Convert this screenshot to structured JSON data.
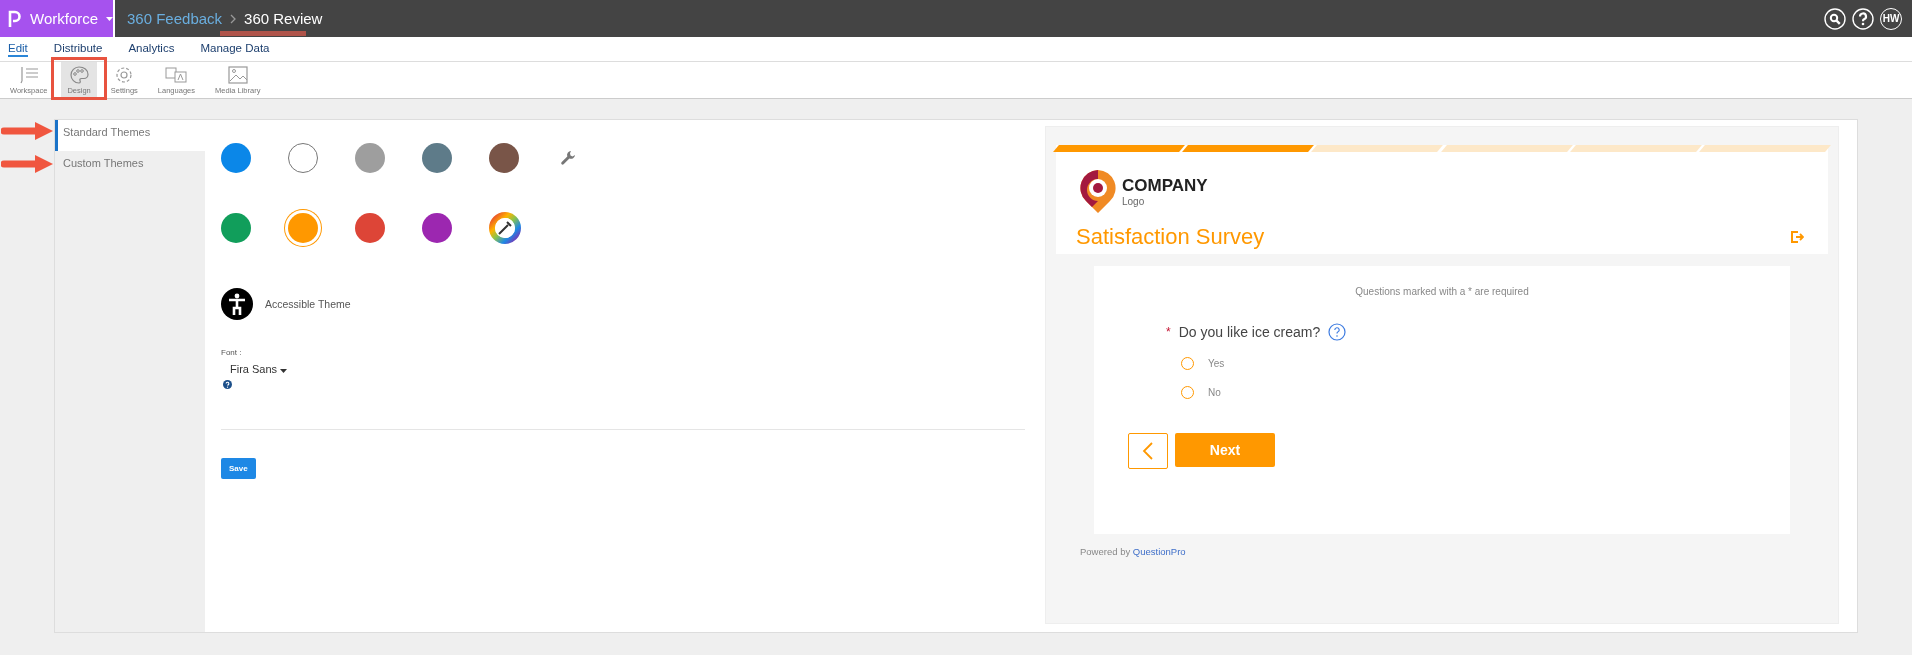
{
  "topbar": {
    "brand": "Workforce",
    "breadcrumb": [
      {
        "label": "360 Feedback",
        "current": false
      },
      {
        "label": "360 Review",
        "current": true
      }
    ],
    "avatar": "HW"
  },
  "menu": [
    {
      "label": "Edit",
      "selected": true
    },
    {
      "label": "Distribute",
      "selected": false
    },
    {
      "label": "Analytics",
      "selected": false
    },
    {
      "label": "Manage Data",
      "selected": false
    }
  ],
  "toolbar": [
    {
      "label": "Workspace",
      "kind": "workspace",
      "selected": false
    },
    {
      "label": "Design",
      "kind": "design",
      "selected": true
    },
    {
      "label": "Settings",
      "kind": "settings",
      "selected": false
    },
    {
      "label": "Languages",
      "kind": "languages",
      "selected": false
    },
    {
      "label": "Media Library",
      "kind": "media",
      "selected": false
    }
  ],
  "sidebar": [
    {
      "label": "Standard Themes",
      "selected": true
    },
    {
      "label": "Custom Themes",
      "selected": false
    }
  ],
  "swatch_rows": [
    [
      {
        "kind": "swatch",
        "color": "#0b87e8",
        "selected": false
      },
      {
        "kind": "swatch",
        "color": "#ffffff",
        "selected": false
      },
      {
        "kind": "swatch",
        "color": "#9e9e9e",
        "selected": false
      },
      {
        "kind": "swatch",
        "color": "#5e7b89",
        "selected": false
      },
      {
        "kind": "swatch",
        "color": "#795548",
        "selected": false
      },
      {
        "kind": "tool"
      }
    ],
    [
      {
        "kind": "swatch",
        "color": "#119e5b",
        "selected": false
      },
      {
        "kind": "swatch",
        "color": "#ff9800",
        "selected": true
      },
      {
        "kind": "swatch",
        "color": "#dd4537",
        "selected": false
      },
      {
        "kind": "swatch",
        "color": "#9c27b0",
        "selected": false
      },
      {
        "kind": "picker"
      }
    ]
  ],
  "accessible_theme": "Accessible Theme",
  "font": {
    "label": "Font :",
    "value": "Fira Sans"
  },
  "save": "Save",
  "preview": {
    "progress": [
      {
        "filled": true
      },
      {
        "filled": true
      },
      {
        "filled": false
      },
      {
        "filled": false
      },
      {
        "filled": false
      },
      {
        "filled": false
      }
    ],
    "company": "COMPANY",
    "logo_sub": "Logo",
    "title": "Satisfaction Survey",
    "required_note": "Questions marked with a * are required",
    "question": {
      "required": true,
      "required_marker": "*",
      "text": "Do you like ice cream?",
      "options": [
        {
          "label": "Yes",
          "selected": false
        },
        {
          "label": "No",
          "selected": false
        }
      ]
    },
    "next": "Next",
    "powered_by": "Powered by",
    "powered_link": "QuestionPro"
  }
}
